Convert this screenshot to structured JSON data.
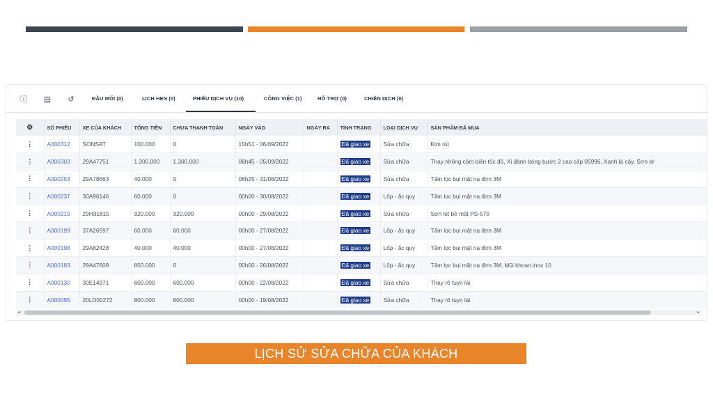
{
  "decor": {
    "colors": {
      "dark": "#3c4650",
      "orange": "#e8842a",
      "gray": "#9aa0a6",
      "status_bg": "#1f3c88",
      "link": "#4a6ee0"
    }
  },
  "tabs": {
    "icons": [
      "info-icon",
      "id-card-icon",
      "history-icon"
    ],
    "items": [
      {
        "label": "ĐẦU MỐI (0)"
      },
      {
        "label": "LỊCH HẸN (0)"
      },
      {
        "label": "PHIẾU DỊCH VỤ (10)"
      },
      {
        "label": "CÔNG VIỆC (1)"
      },
      {
        "label": "HỖ TRỢ (0)"
      },
      {
        "label": "CHIẾN DỊCH (0)"
      }
    ],
    "active": "PHIẾU DỊCH VỤ (10)"
  },
  "table": {
    "columns": [
      "SỐ PHIẾU",
      "XE CỦA KHÁCH",
      "TỔNG TIỀN",
      "CHƯA THANH TOÁN",
      "NGÀY VÀO",
      "NGÀY RA",
      "TÌNH TRẠNG",
      "LOẠI DỊCH VỤ",
      "SẢN PHẨM ĐÃ MUA"
    ],
    "rows": [
      {
        "code": "A000312",
        "car": "SONSAT",
        "total": "100.000",
        "unpaid": "0",
        "date_in": "15h51 - 06/09/2022",
        "date_out": "",
        "status": "Đã giao xe",
        "service": "Sửa chữa",
        "products": "Kim rút"
      },
      {
        "code": "A000303",
        "car": "29A47751",
        "total": "1.300.000",
        "unpaid": "1.300.000",
        "date_in": "08h45 - 05/09/2022",
        "date_out": "",
        "status": "Đã giao xe",
        "service": "Sửa chữa",
        "products": "Thay nhông cảm biến tốc độ, Xi đánh bóng bước 2 cao cấp 05996, Xanh lá cây, Sơn lớ"
      },
      {
        "code": "A000253",
        "car": "29A78663",
        "total": "40.000",
        "unpaid": "0",
        "date_in": "08h25 - 31/08/2022",
        "date_out": "",
        "status": "Đã giao xe",
        "service": "Sửa chữa",
        "products": "Tấm lọc bụi mặt nạ đơn 3M"
      },
      {
        "code": "A000237",
        "car": "30A96146",
        "total": "60.000",
        "unpaid": "0",
        "date_in": "00h00 - 30/08/2022",
        "date_out": "",
        "status": "Đã giao xe",
        "service": "Lốp - ắc quy",
        "products": "Tấm lọc bụi mặt nạ đơn 3M"
      },
      {
        "code": "A000219",
        "car": "29H31815",
        "total": "320.000",
        "unpaid": "320.000",
        "date_in": "00h00 - 29/08/2022",
        "date_out": "",
        "status": "Đã giao xe",
        "service": "Sửa chữa",
        "products": "Sơn lót bề mặt PS-570"
      },
      {
        "code": "A000199",
        "car": "37A26597",
        "total": "60.000",
        "unpaid": "60.000",
        "date_in": "00h00 - 27/08/2022",
        "date_out": "",
        "status": "Đã giao xe",
        "service": "Lốp - ắc quy",
        "products": "Tấm lọc bụi mặt nạ đơn 3M"
      },
      {
        "code": "A000198",
        "car": "29A82428",
        "total": "40.000",
        "unpaid": "40.000",
        "date_in": "00h00 - 27/08/2022",
        "date_out": "",
        "status": "Đã giao xe",
        "service": "Lốp - ắc quy",
        "products": "Tấm lọc bụi mặt nạ đơn 3M"
      },
      {
        "code": "A000183",
        "car": "29A47609",
        "total": "850.000",
        "unpaid": "0",
        "date_in": "00h00 - 26/08/2022",
        "date_out": "",
        "status": "Đã giao xe",
        "service": "Lốp - ắc quy",
        "products": "Tấm lọc bụi mặt nạ đơn 3M, Mũi khoan inox 10"
      },
      {
        "code": "A000130",
        "car": "30E14971",
        "total": "600.000",
        "unpaid": "600.000",
        "date_in": "00h00 - 22/08/2022",
        "date_out": "",
        "status": "Đã giao xe",
        "service": "Sửa chữa",
        "products": "Thay rô tuyn lái"
      },
      {
        "code": "A000095",
        "car": "20LD00272",
        "total": "800.000",
        "unpaid": "800.000",
        "date_in": "00h00 - 19/08/2022",
        "date_out": "",
        "status": "Đã giao xe",
        "service": "Sửa chữa",
        "products": "Thay rô tuyn lái"
      }
    ]
  },
  "caption": "LỊCH SỬ SỬA CHỮA CỦA KHÁCH"
}
